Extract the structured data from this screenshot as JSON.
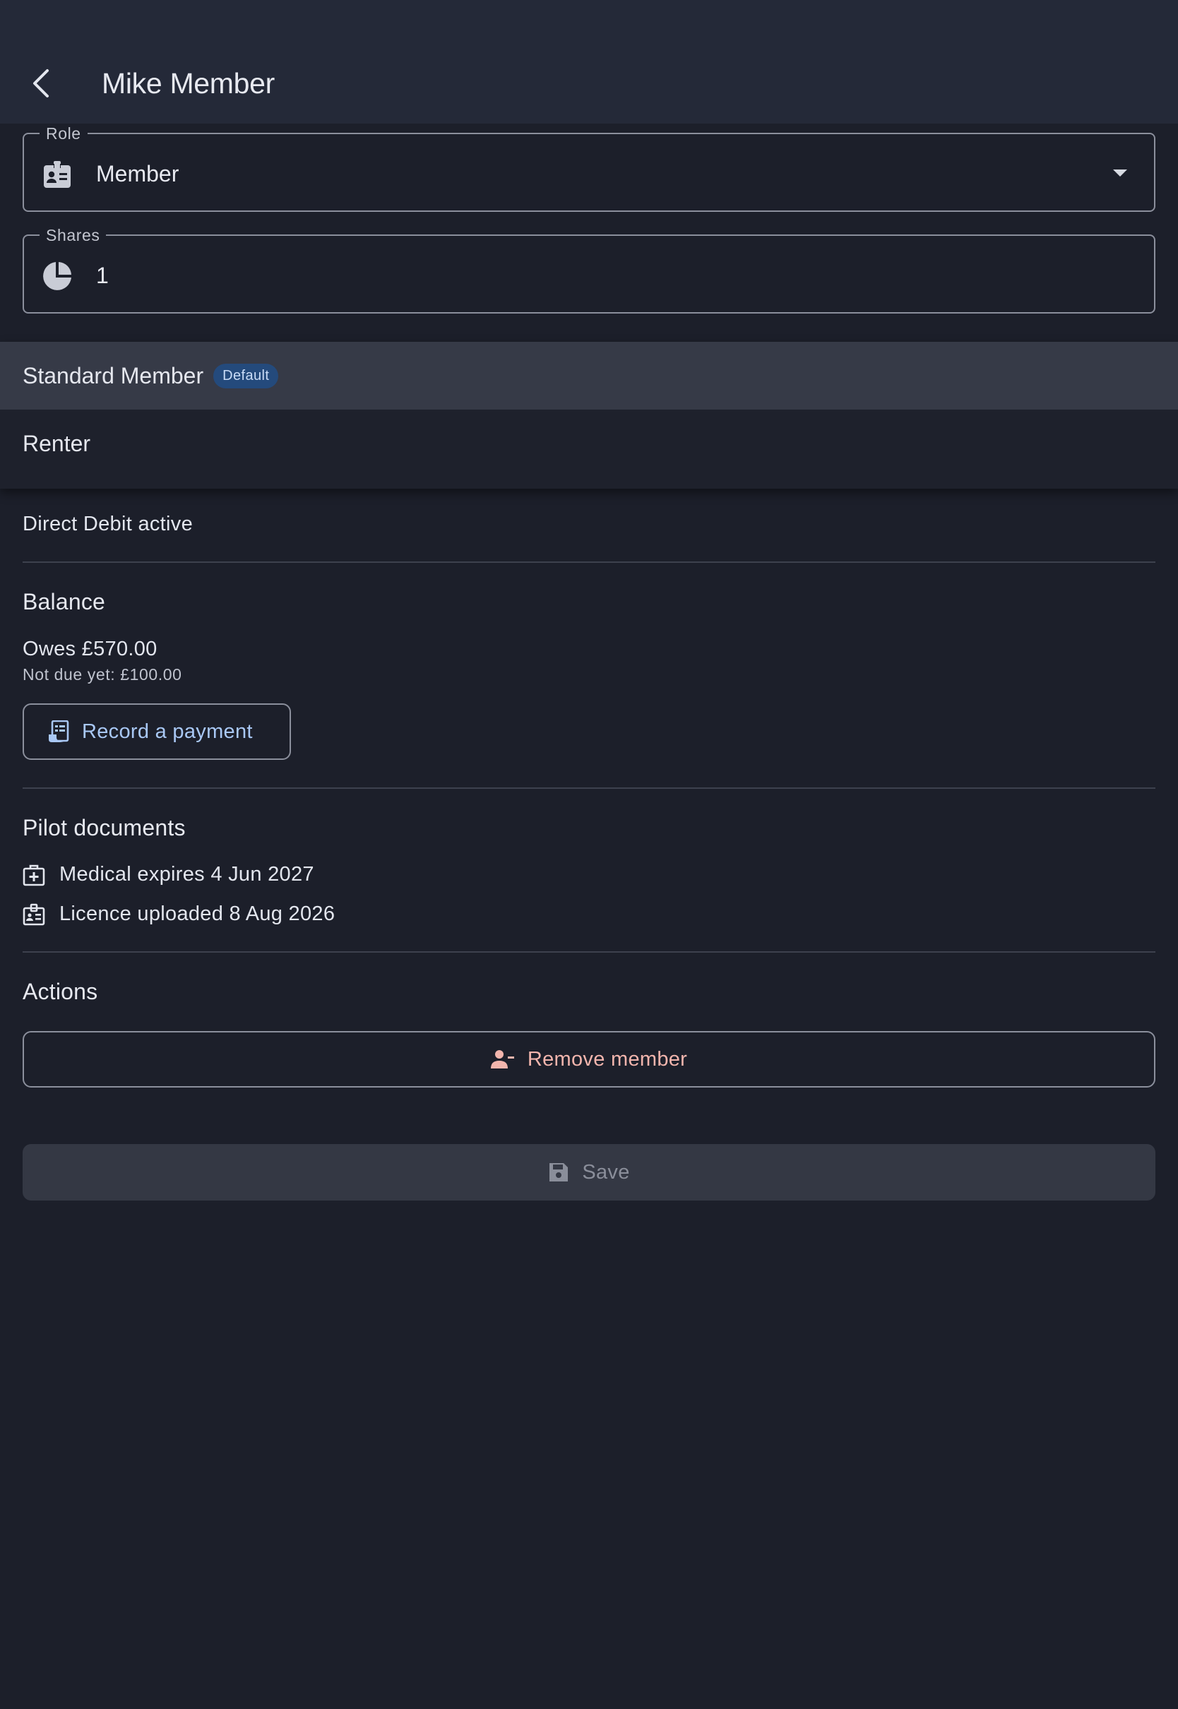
{
  "header": {
    "title": "Mike Member"
  },
  "role_field": {
    "label": "Role",
    "value": "Member"
  },
  "shares_field": {
    "label": "Shares",
    "value": "1"
  },
  "role_menu": {
    "items": [
      {
        "label": "Standard Member",
        "badge": "Default",
        "selected": true
      },
      {
        "label": "Renter",
        "selected": false
      }
    ]
  },
  "payment": {
    "status": "Direct Debit active"
  },
  "balance": {
    "title": "Balance",
    "owes": "Owes £570.00",
    "not_due": "Not due yet: £100.00",
    "record_payment_label": "Record a payment"
  },
  "pilot_documents": {
    "title": "Pilot documents",
    "items": [
      {
        "label": "Medical expires 4 Jun 2027",
        "icon": "medical-bag-icon"
      },
      {
        "label": "Licence uploaded 8 Aug 2026",
        "icon": "licence-badge-icon"
      }
    ]
  },
  "actions": {
    "title": "Actions",
    "remove_label": "Remove member"
  },
  "save": {
    "label": "Save"
  },
  "colors": {
    "background": "#1c1f2a",
    "app_bar": "#242938",
    "accent_blue": "#a9c8f5",
    "danger": "#f2b5ad",
    "badge_bg": "#244a7c"
  }
}
